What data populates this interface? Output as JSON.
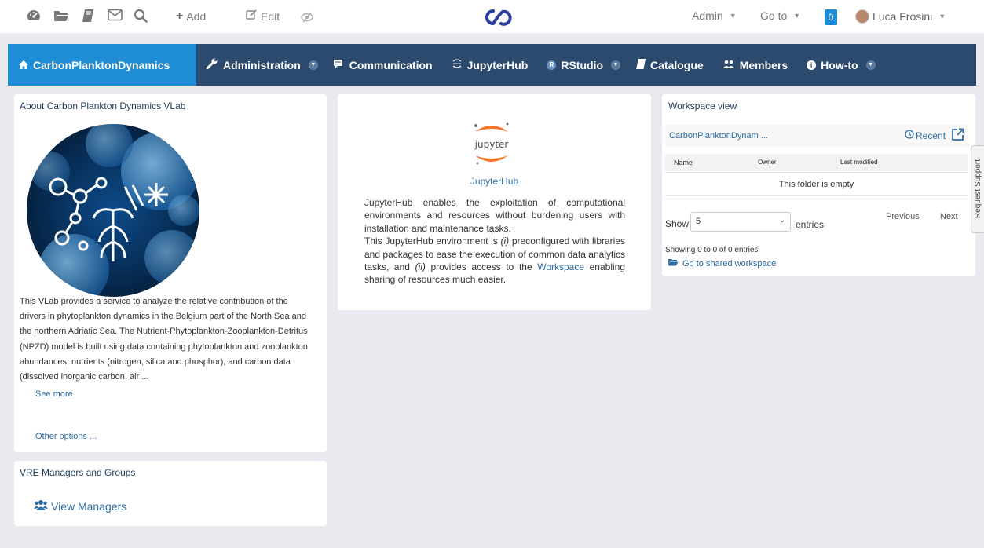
{
  "topbar": {
    "icons": [
      "dashboard-icon",
      "folder-icon",
      "book-icon",
      "mail-icon",
      "search-icon"
    ],
    "add_label": "Add",
    "edit_label": "Edit",
    "admin_label": "Admin",
    "goto_label": "Go to",
    "notif_count": "0",
    "user_name": "Luca Frosini"
  },
  "nav": {
    "items": [
      {
        "label": "CarbonPlanktonDynamics",
        "icon": "home-icon"
      },
      {
        "label": "Administration",
        "icon": "wrench-icon"
      },
      {
        "label": "Communication",
        "icon": "chat-icon"
      },
      {
        "label": "JupyterHub",
        "icon": "jupyter-icon"
      },
      {
        "label": "RStudio",
        "icon": "rstudio-icon"
      },
      {
        "label": "Catalogue",
        "icon": "book-icon"
      },
      {
        "label": "Members",
        "icon": "users-icon"
      },
      {
        "label": "How-to",
        "icon": "info-icon"
      }
    ]
  },
  "about": {
    "title": "About Carbon Plankton Dynamics VLab",
    "description": "This VLab provides a service to analyze the relative contribution of the drivers in phytoplankton dynamics in the Belgium part of the North Sea and the northern Adriatic Sea. The Nutrient-Phytoplankton-Zooplankton-Detritus (NPZD) model is built using data containing phytoplankton and zooplankton abundances, nutrients (nitrogen, silica and phosphor), and carbon data (dissolved inorganic carbon, air ...",
    "see_more": "See more",
    "other_options": "Other options ..."
  },
  "managers": {
    "title": "VRE Managers and Groups",
    "view_managers": "View Managers"
  },
  "jupyter": {
    "logo_text": "jupyter",
    "link_title": "JupyterHub",
    "p1": "JupyterHub enables the exploitation of computational environments and resources without burdening users with installation and maintenance tasks.",
    "p2_a": "This JupyterHub environment is ",
    "p2_i": "(i)",
    "p2_b": " preconfigured with libraries and packages to ease the execution of common data analytics tasks, and ",
    "p2_ii": "(ii)",
    "p2_c": " provides access to the ",
    "p2_link": "Workspace",
    "p2_d": " enabling sharing of resources much easier."
  },
  "workspace": {
    "title": "Workspace view",
    "folder": "CarbonPlanktonDynam ...",
    "recent": "Recent",
    "columns": [
      "Name",
      "Owner",
      "Last modified"
    ],
    "empty": "This folder is empty",
    "show_label": "Show",
    "show_value": "5",
    "entries_label": "entries",
    "previous": "Previous",
    "next": "Next",
    "showing": "Showing 0 to 0 of 0 entries",
    "shared": "Go to shared workspace"
  },
  "request_support": "Request Support",
  "colors": {
    "navbar": "#2c4a6e",
    "active_tab": "#1f8dd6",
    "link": "#2e6da4",
    "jupyter_orange": "#f37726"
  }
}
